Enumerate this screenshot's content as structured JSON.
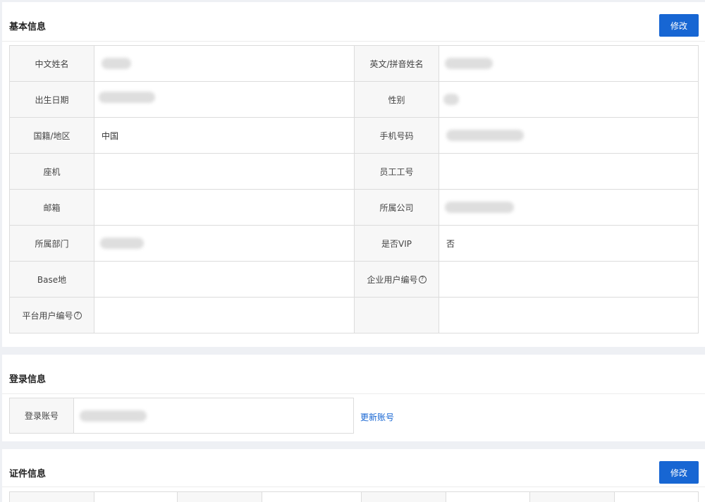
{
  "basic": {
    "title": "基本信息",
    "edit_label": "修改",
    "rows": [
      [
        {
          "label": "中文姓名",
          "value": ""
        },
        {
          "label": "英文/拼音姓名",
          "value": ""
        }
      ],
      [
        {
          "label": "出生日期",
          "value": ""
        },
        {
          "label": "性别",
          "value": ""
        }
      ],
      [
        {
          "label": "国籍/地区",
          "value": "中国"
        },
        {
          "label": "手机号码",
          "value": ""
        }
      ],
      [
        {
          "label": "座机",
          "value": ""
        },
        {
          "label": "员工工号",
          "value": ""
        }
      ],
      [
        {
          "label": "邮箱",
          "value": ""
        },
        {
          "label": "所属公司",
          "value": ""
        }
      ],
      [
        {
          "label": "所属部门",
          "value": ""
        },
        {
          "label": "是否VIP",
          "value": "否"
        }
      ],
      [
        {
          "label": "Base地",
          "value": ""
        },
        {
          "label": "企业用户编号",
          "value": ""
        }
      ],
      [
        {
          "label": "平台用户编号",
          "value": ""
        },
        {
          "label": "",
          "value": ""
        }
      ]
    ],
    "help_glyph": "?"
  },
  "login": {
    "title": "登录信息",
    "account_label": "登录账号",
    "account_value": "",
    "update_link": "更新账号"
  },
  "cert": {
    "title": "证件信息",
    "edit_label": "修改"
  }
}
